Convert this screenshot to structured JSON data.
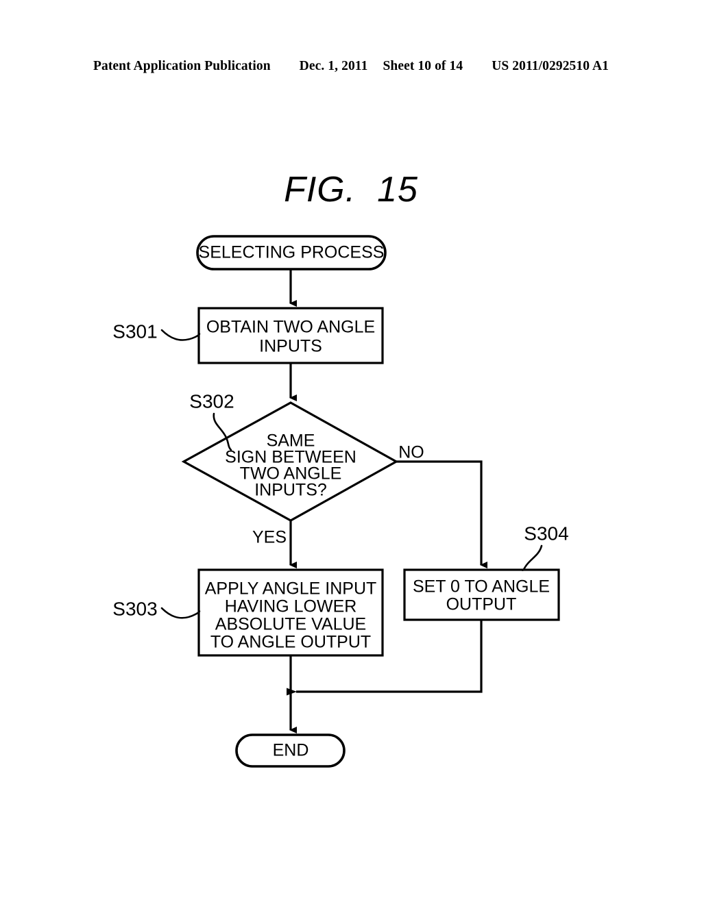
{
  "header": {
    "publication": "Patent Application Publication",
    "date": "Dec. 1, 2011",
    "sheet": "Sheet 10 of 14",
    "number": "US 2011/0292510 A1"
  },
  "figure": {
    "title": "FIG.  15"
  },
  "flowchart": {
    "start": {
      "ref": "",
      "label": "SELECTING PROCESS"
    },
    "s301": {
      "ref": "S301",
      "line1": "OBTAIN TWO ANGLE",
      "line2": "INPUTS"
    },
    "s302": {
      "ref": "S302",
      "line1": "SAME",
      "line2": "SIGN BETWEEN",
      "line3": "TWO ANGLE",
      "line4": "INPUTS?"
    },
    "s303": {
      "ref": "S303",
      "line1": "APPLY ANGLE INPUT",
      "line2": "HAVING LOWER",
      "line3": "ABSOLUTE VALUE",
      "line4": "TO ANGLE OUTPUT"
    },
    "s304": {
      "ref": "S304",
      "line1": "SET 0 TO ANGLE",
      "line2": "OUTPUT"
    },
    "branches": {
      "yes": "YES",
      "no": "NO"
    },
    "end": {
      "label": "END"
    }
  },
  "colors": {
    "ink": "#000000",
    "paper": "#ffffff"
  }
}
